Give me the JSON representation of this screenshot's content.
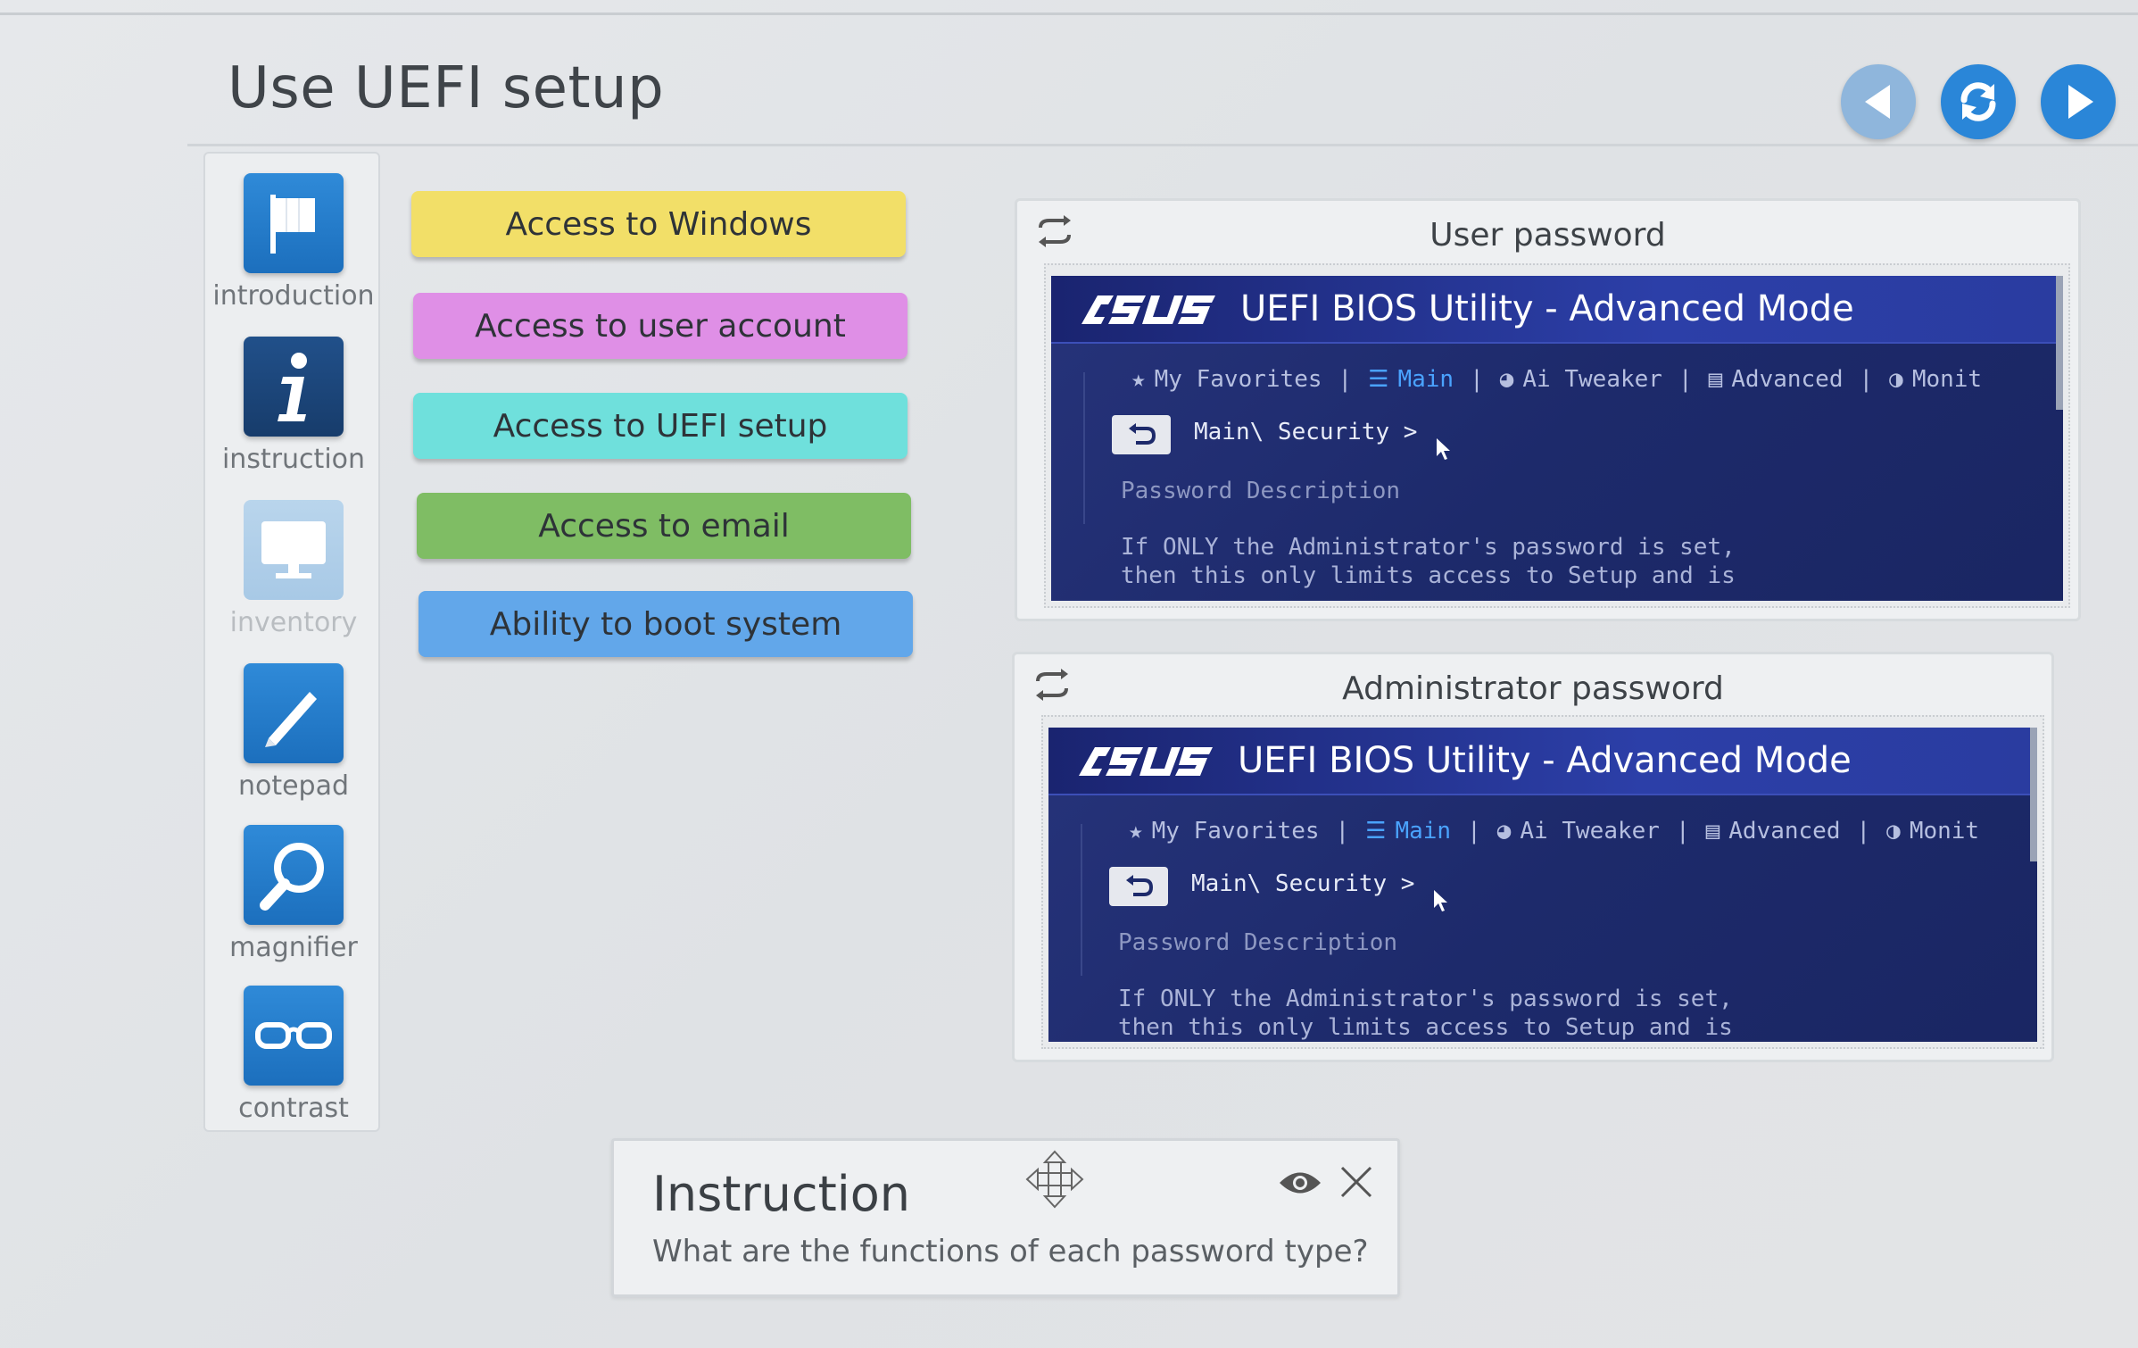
{
  "header": {
    "title": "Use UEFI setup"
  },
  "nav": {
    "back_icon": "arrow-left-icon",
    "reload_icon": "reload-icon",
    "next_icon": "arrow-right-icon"
  },
  "toolbar": {
    "items": [
      {
        "label": "introduction",
        "icon": "flag-icon",
        "enabled": true
      },
      {
        "label": "instruction",
        "icon": "info-icon",
        "enabled": true
      },
      {
        "label": "inventory",
        "icon": "monitor-icon",
        "enabled": false
      },
      {
        "label": "notepad",
        "icon": "pencil-icon",
        "enabled": true
      },
      {
        "label": "magnifier",
        "icon": "magnifier-icon",
        "enabled": true
      },
      {
        "label": "contrast",
        "icon": "glasses-icon",
        "enabled": true
      }
    ]
  },
  "answers": {
    "items": [
      {
        "label": "Access to Windows",
        "color": "#f2df68"
      },
      {
        "label": "Access to user account",
        "color": "#df8fe6"
      },
      {
        "label": "Access to UEFI setup",
        "color": "#6fe0dc"
      },
      {
        "label": "Access to email",
        "color": "#7fbd64"
      },
      {
        "label": "Ability to boot system",
        "color": "#62a7ea"
      }
    ]
  },
  "panels": {
    "user": {
      "title": "User password",
      "bios": {
        "brand": "ASUS",
        "title": "UEFI BIOS Utility - Advanced Mode",
        "tabs": [
          "My Favorites",
          "Main",
          "Ai Tweaker",
          "Advanced",
          "Monit"
        ],
        "active_tab": "Main",
        "path": "Main\\ Security >",
        "desc": "Password Description",
        "text_line1": "If ONLY the Administrator's password is set,",
        "text_line2": "then this only limits access to Setup and is"
      }
    },
    "admin": {
      "title": "Administrator password",
      "bios": {
        "brand": "ASUS",
        "title": "UEFI BIOS Utility - Advanced Mode",
        "tabs": [
          "My Favorites",
          "Main",
          "Ai Tweaker",
          "Advanced",
          "Monit"
        ],
        "active_tab": "Main",
        "path": "Main\\ Security >",
        "desc": "Password Description",
        "text_line1": "If ONLY the Administrator's password is set,",
        "text_line2": "then this only limits access to Setup and is"
      }
    }
  },
  "instruction": {
    "title": "Instruction",
    "text": "What are the functions of each password type?"
  }
}
